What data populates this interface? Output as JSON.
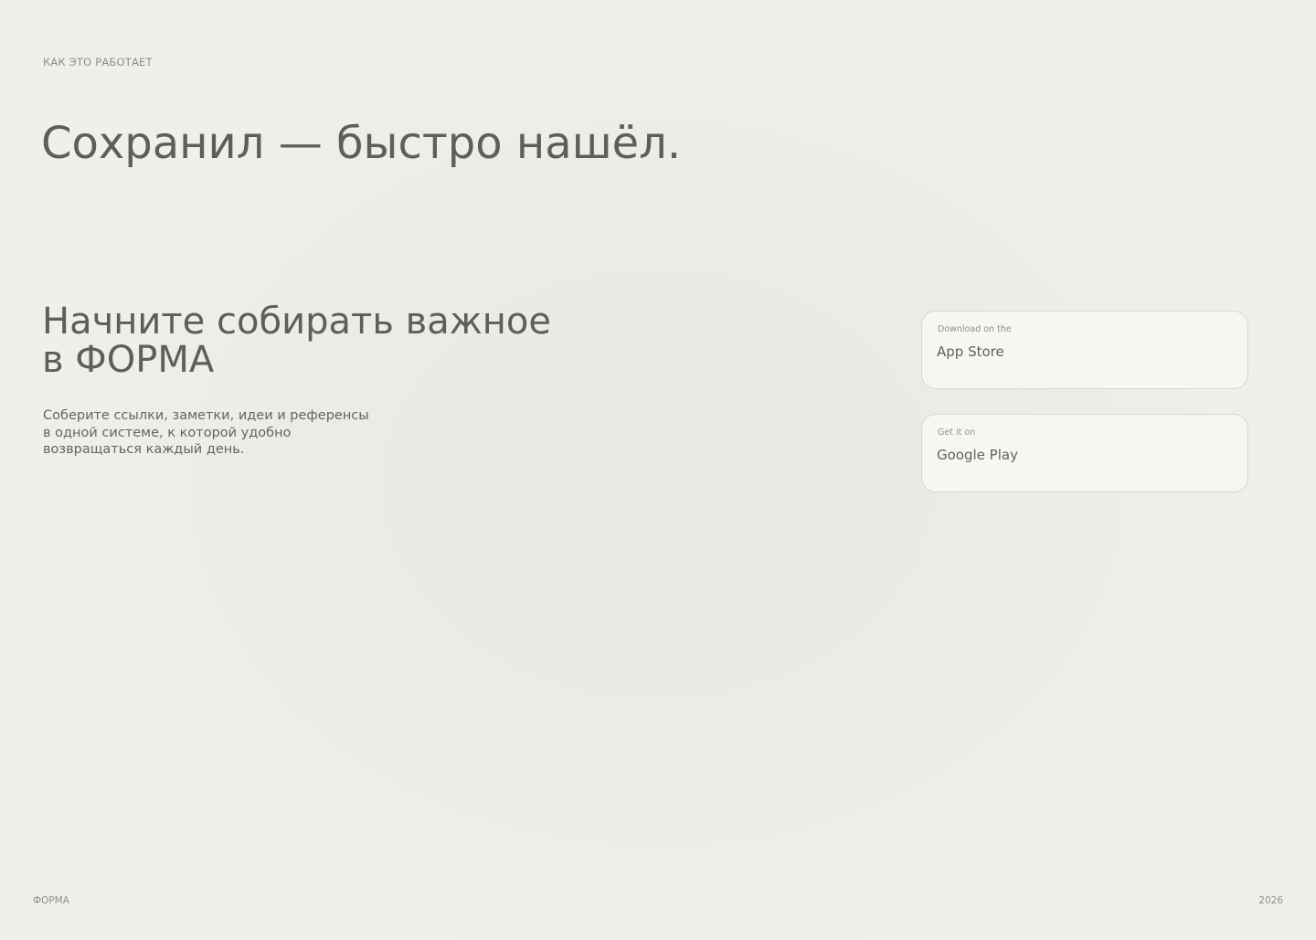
{
  "section": {
    "eyebrow": "КАК ЭТО РАБОТАЕТ",
    "title": "Сохранил — быстро нашёл."
  },
  "cta": {
    "title_lines": [
      "Начните собирать важное",
      "в ФОРМА"
    ],
    "description_lines": [
      "Соберите ссылки, заметки, идеи и референсы",
      "в одной системе, к которой удобно",
      "возвращаться каждый день."
    ]
  },
  "stores": [
    {
      "small": "Download on the",
      "name": "App Store"
    },
    {
      "small": "Get it on",
      "name": "Google Play"
    }
  ],
  "footer": {
    "brand": "ФОРМА",
    "year": "2026"
  },
  "colors": {
    "background": "#eeefeb",
    "text": "#5c6057",
    "muted": "#8b8e86",
    "button_bg": "#f6f7f3",
    "button_border": "#d7d9d2"
  }
}
